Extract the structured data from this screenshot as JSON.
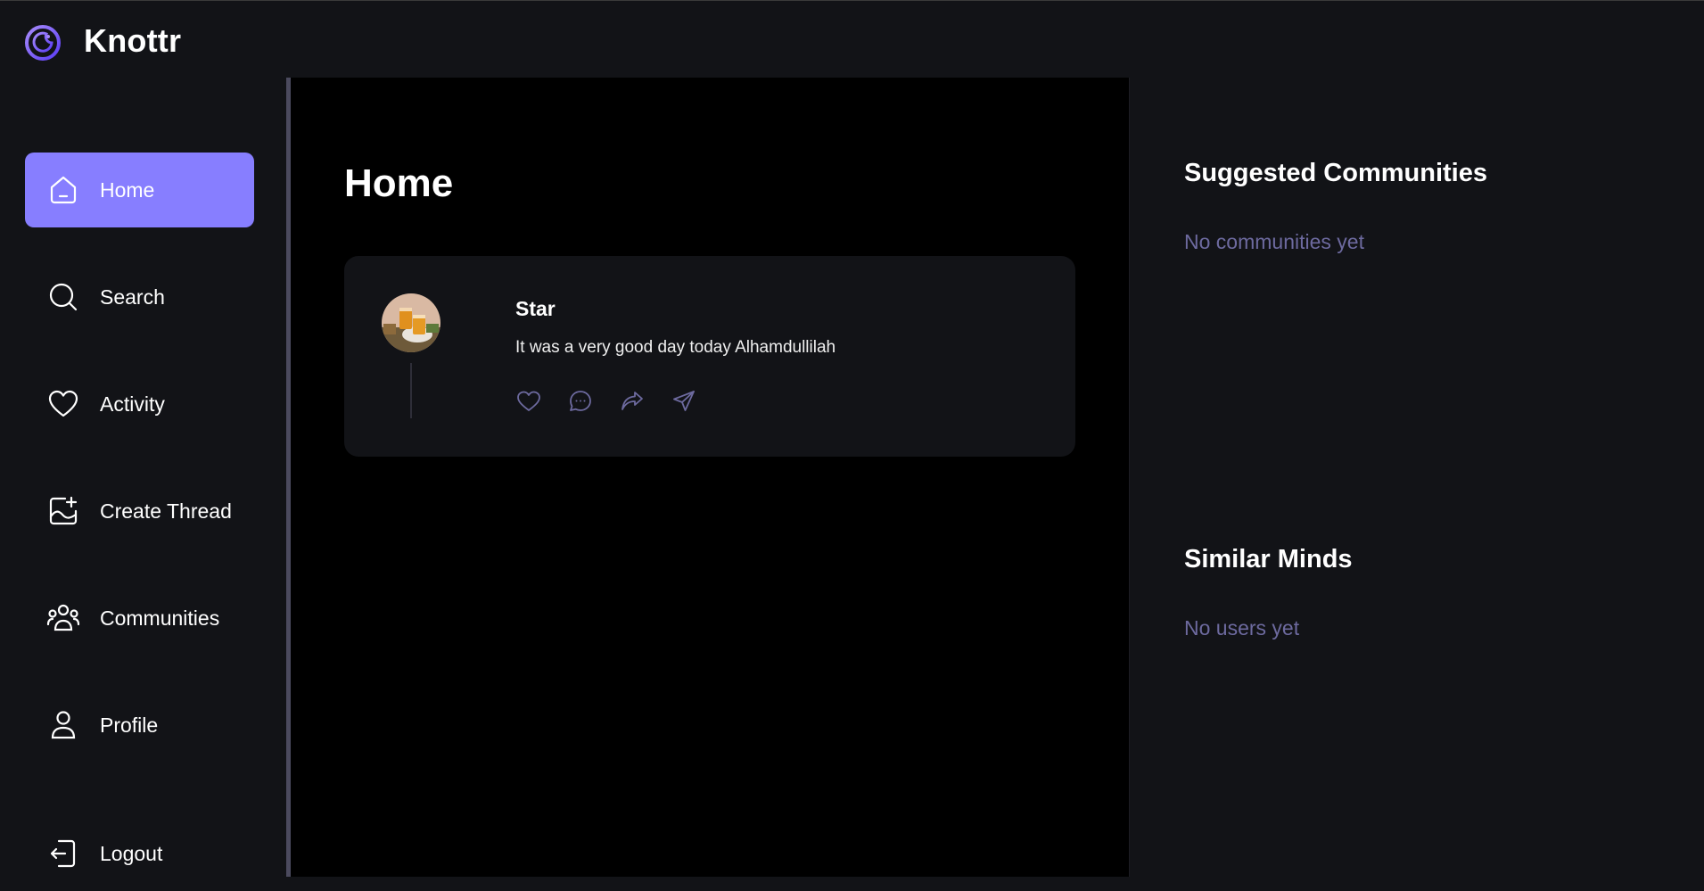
{
  "app": {
    "name": "Knottr"
  },
  "colors": {
    "accent": "#877eff",
    "background": "#121317",
    "main_background": "#000000",
    "muted_text": "#6d6a9f"
  },
  "sidebar": {
    "items": [
      {
        "label": "Home",
        "icon": "home-icon",
        "active": true
      },
      {
        "label": "Search",
        "icon": "search-icon",
        "active": false
      },
      {
        "label": "Activity",
        "icon": "heart-icon",
        "active": false
      },
      {
        "label": "Create Thread",
        "icon": "image-plus-icon",
        "active": false
      },
      {
        "label": "Communities",
        "icon": "users-icon",
        "active": false
      },
      {
        "label": "Profile",
        "icon": "user-icon",
        "active": false
      }
    ],
    "logout_label": "Logout"
  },
  "main": {
    "title": "Home",
    "threads": [
      {
        "author": "Star",
        "content": "It was a very good day today Alhamdullilah",
        "actions": [
          "heart-icon",
          "reply-icon",
          "repost-icon",
          "share-icon"
        ]
      }
    ]
  },
  "right_panel": {
    "suggested": {
      "title": "Suggested Communities",
      "empty_text": "No communities yet"
    },
    "similar": {
      "title": "Similar Minds",
      "empty_text": "No users yet"
    }
  }
}
